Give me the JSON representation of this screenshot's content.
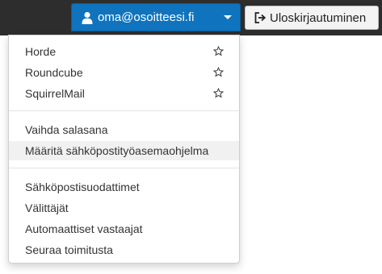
{
  "header": {
    "user_label": "oma@osoitteesi.fi",
    "logout_label": "Uloskirjautuminen"
  },
  "menu": {
    "webmail": [
      {
        "label": "Horde",
        "icon": "star-outline-icon"
      },
      {
        "label": "Roundcube",
        "icon": "star-outline-icon"
      },
      {
        "label": "SquirrelMail",
        "icon": "star-outline-icon"
      }
    ],
    "account": [
      {
        "label": "Vaihda salasana"
      },
      {
        "label": "Määritä sähköpostityöasemaohjelma",
        "highlighted": true
      }
    ],
    "mail_settings": [
      {
        "label": "Sähköpostisuodattimet"
      },
      {
        "label": "Välittäjät"
      },
      {
        "label": "Automaattiset vastaajat"
      },
      {
        "label": "Seuraa toimitusta"
      }
    ]
  },
  "colors": {
    "topbar": "#2d2d2d",
    "accent": "#0f74bd",
    "highlight_row": "#f1f1f1"
  }
}
